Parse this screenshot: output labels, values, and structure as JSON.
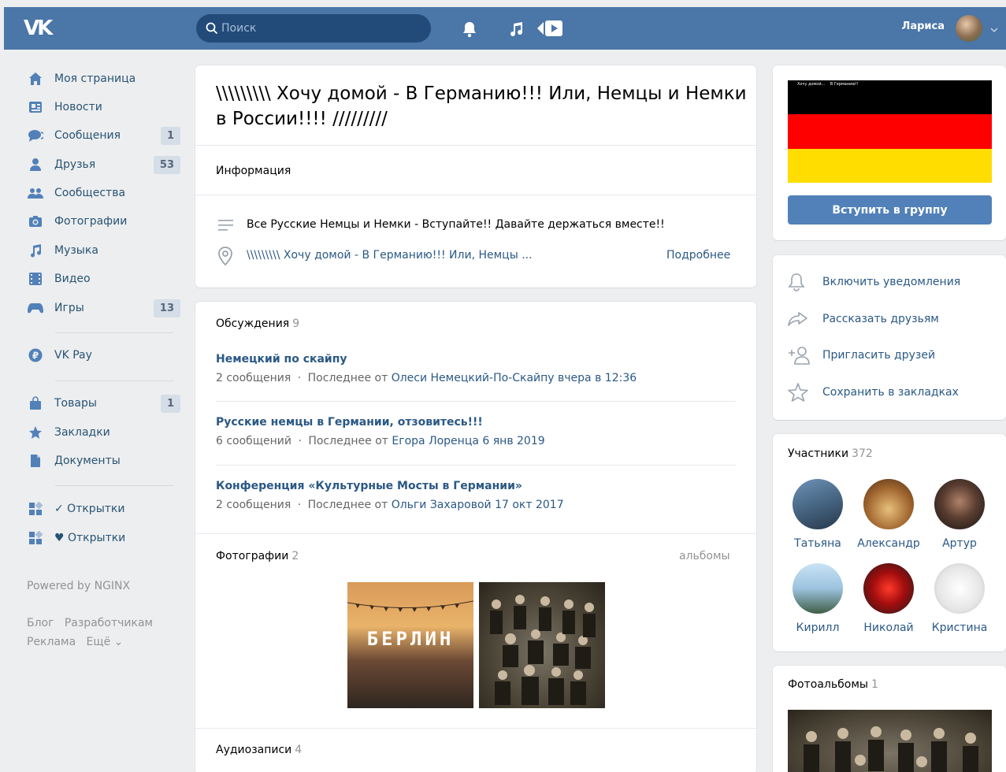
{
  "header": {
    "logo": "VK",
    "search_placeholder": "Поиск",
    "user_name": "Лариса"
  },
  "sidebar": {
    "items": [
      {
        "label": "Моя страница",
        "icon": "home-icon",
        "badge": ""
      },
      {
        "label": "Новости",
        "icon": "news-icon",
        "badge": ""
      },
      {
        "label": "Сообщения",
        "icon": "messages-icon",
        "badge": "1"
      },
      {
        "label": "Друзья",
        "icon": "friends-icon",
        "badge": "53"
      },
      {
        "label": "Сообщества",
        "icon": "groups-icon",
        "badge": ""
      },
      {
        "label": "Фотографии",
        "icon": "camera-icon",
        "badge": ""
      },
      {
        "label": "Музыка",
        "icon": "music-icon",
        "badge": ""
      },
      {
        "label": "Видео",
        "icon": "video-icon",
        "badge": ""
      },
      {
        "label": "Игры",
        "icon": "gamepad-icon",
        "badge": "13"
      },
      {
        "label": "VK Pay",
        "icon": "vkpay-icon",
        "badge": ""
      },
      {
        "label": "Товары",
        "icon": "bag-icon",
        "badge": "1"
      },
      {
        "label": "Закладки",
        "icon": "star-icon",
        "badge": ""
      },
      {
        "label": "Документы",
        "icon": "document-icon",
        "badge": ""
      },
      {
        "label": "✓ Открытки",
        "icon": "apps-icon",
        "badge": ""
      },
      {
        "label": "♥ Открытки",
        "icon": "apps-icon",
        "badge": ""
      }
    ],
    "powered": "Powered by NGINX",
    "footer_links": [
      "Блог",
      "Разработчикам",
      "Реклама",
      "Ещё ⌄"
    ]
  },
  "group": {
    "title": "\\\\\\\\\\\\\\\\\\ Хочу домой - В Германию!!! Или, Немцы и Немки в России!!!! /////////",
    "info_label": "Информация",
    "description": "Все Русские Немцы и Немки - Вступайте!! Давайте держаться вместе!!",
    "address": "\\\\\\\\\\\\\\\\\\ Хочу домой - В Германию!!! Или, Немцы ...",
    "more": "Подробнее"
  },
  "discussions": {
    "label": "Обсуждения",
    "count": "9",
    "topics": [
      {
        "title": "Немецкий по скайпу",
        "messages": "2 сообщения",
        "sep": "·",
        "last_prefix": "Последнее от",
        "author": "Олеси Немецкий-По-Скайпу",
        "date": "вчера в 12:36"
      },
      {
        "title": "Русские немцы в Германии, отзовитесь!!!",
        "messages": "6 сообщений",
        "sep": "·",
        "last_prefix": "Последнее от",
        "author": "Егора Лоренца",
        "date": "6 янв 2019"
      },
      {
        "title": "Конференция «Культурные Мосты в Германии»",
        "messages": "2 сообщения",
        "sep": "·",
        "last_prefix": "Последнее от",
        "author": "Ольги Захаровой",
        "date": "17 окт 2017"
      }
    ]
  },
  "photos": {
    "label": "Фотографии",
    "count": "2",
    "albums_link": "альбомы",
    "photo1_text": "БЕРЛИН"
  },
  "audio": {
    "label": "Аудиозаписи",
    "count": "4"
  },
  "right": {
    "cover_caption": "Хочу домой...    В Германию!!",
    "join_button": "Вступить в группу",
    "actions": [
      {
        "label": "Включить уведомления",
        "icon": "bell-icon"
      },
      {
        "label": "Рассказать друзьям",
        "icon": "share-icon"
      },
      {
        "label": "Пригласить друзей",
        "icon": "add-friend-icon"
      },
      {
        "label": "Сохранить в закладках",
        "icon": "star-outline-icon"
      }
    ],
    "members_label": "Участники",
    "members_count": "372",
    "members": [
      "Татьяна",
      "Александр",
      "Артур",
      "Кирилл",
      "Николай",
      "Кристина"
    ],
    "albums_label": "Фотоальбомы",
    "albums_count": "1"
  },
  "colors": {
    "header": "#4a76a8",
    "link": "#2a5885",
    "button": "#5181b8",
    "flag_black": "#000000",
    "flag_red": "#ff0000",
    "flag_gold": "#ffdd00"
  }
}
